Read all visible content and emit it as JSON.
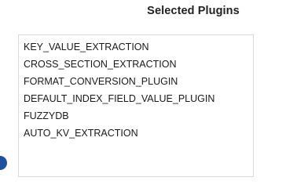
{
  "selected_plugins": {
    "title": "Selected Plugins",
    "items": [
      "KEY_VALUE_EXTRACTION",
      "CROSS_SECTION_EXTRACTION",
      "FORMAT_CONVERSION_PLUGIN",
      "DEFAULT_INDEX_FIELD_VALUE_PLUGIN",
      "FUZZYDB",
      "AUTO_KV_EXTRACTION"
    ]
  },
  "colors": {
    "handle": "#1f4fa3",
    "border": "#d9d9d9"
  }
}
